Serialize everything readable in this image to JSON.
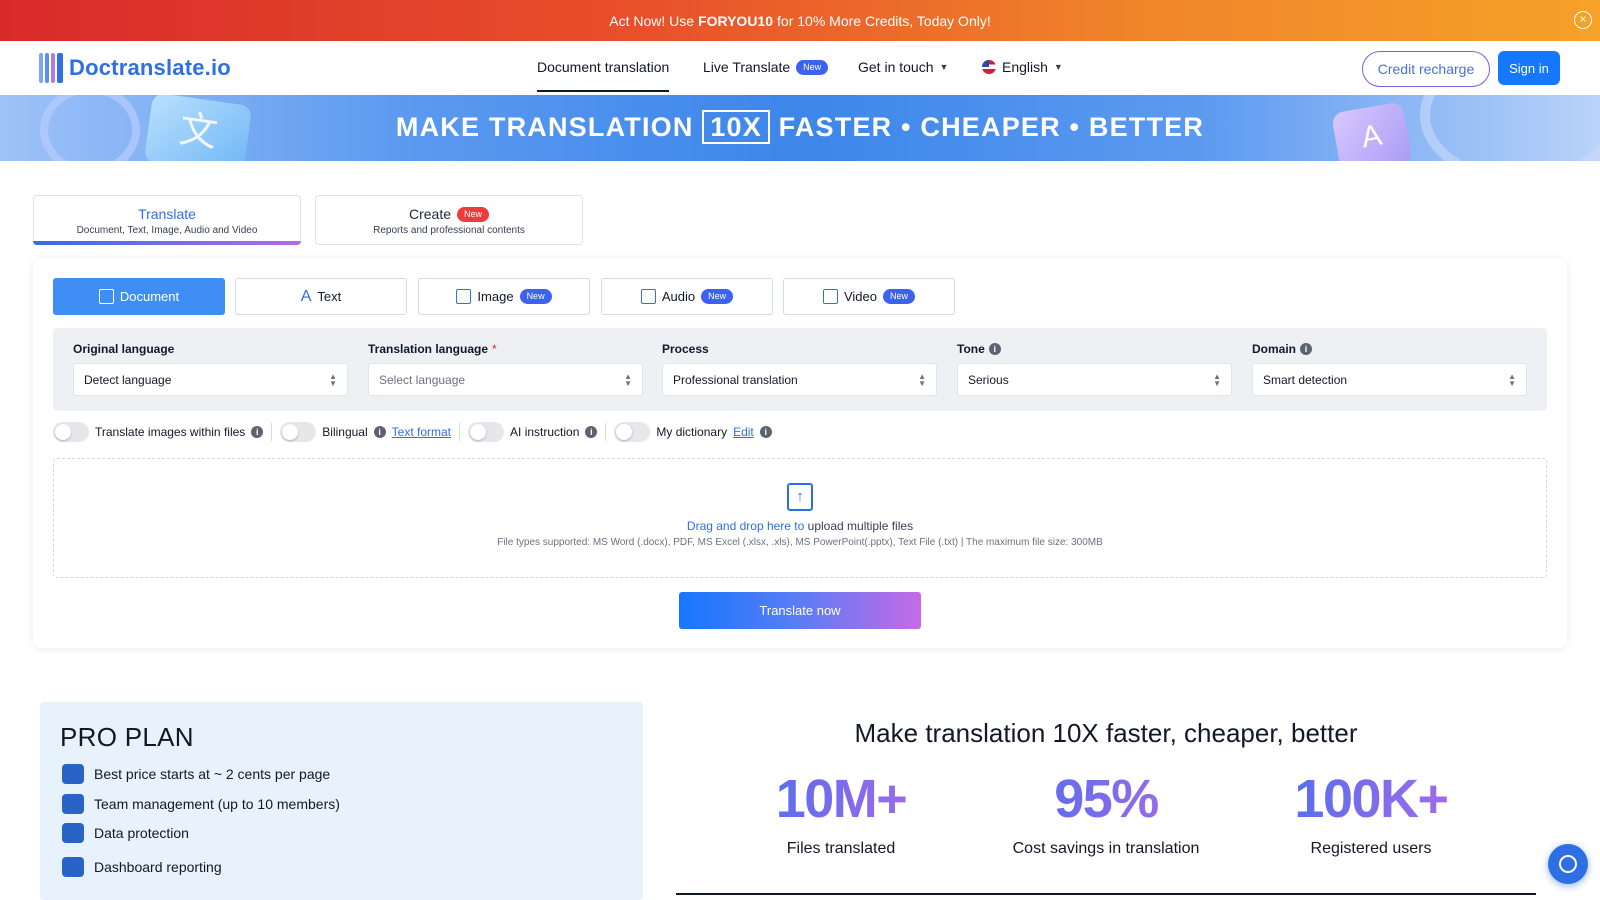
{
  "promo": {
    "prefix": "Act Now! Use",
    "code": "FORYOU10",
    "suffix": "for 10% More Credits, Today Only!"
  },
  "nav": {
    "logo": "Doctranslate.io",
    "links": {
      "document": "Document translation",
      "live": "Live Translate",
      "contact": "Get in touch",
      "language": "English"
    },
    "new_badge": "New",
    "credit": "Credit recharge",
    "signin": "Sign in"
  },
  "banner": {
    "part1": "MAKE TRANSLATION",
    "boxed": "10X",
    "part2": "FASTER • CHEAPER • BETTER",
    "deco1": "文",
    "deco2": "A"
  },
  "modes": {
    "translate": {
      "title": "Translate",
      "sub": "Document, Text, Image, Audio and Video"
    },
    "create": {
      "title": "Create",
      "badge": "New",
      "sub": "Reports and professional contents"
    }
  },
  "types": {
    "document": "Document",
    "text": "Text",
    "image": "Image",
    "audio": "Audio",
    "video": "Video",
    "new_badge": "New"
  },
  "fields": {
    "original": {
      "label": "Original language",
      "value": "Detect language"
    },
    "translation": {
      "label": "Translation language",
      "required": "*",
      "placeholder": "Select language"
    },
    "process": {
      "label": "Process",
      "value": "Professional translation"
    },
    "tone": {
      "label": "Tone",
      "value": "Serious"
    },
    "domain": {
      "label": "Domain",
      "value": "Smart detection"
    }
  },
  "options": {
    "images": "Translate images within files",
    "bilingual": "Bilingual",
    "text_format": "Text format",
    "ai": "AI instruction",
    "dictionary": "My dictionary",
    "edit": "Edit"
  },
  "upload": {
    "link": "Drag and drop here to",
    "rest": "upload multiple files",
    "types": "File types supported: MS Word (.docx), PDF, MS Excel (.xlsx, .xls), MS PowerPoint(.pptx), Text File (.txt) | The maximum file size: 300MB"
  },
  "translate_btn": "Translate now",
  "pro": {
    "title": "PRO PLAN",
    "items": [
      "Best price starts at ~ 2 cents per page",
      "Team management (up to 10 members)",
      "Data protection",
      "Dashboard reporting"
    ]
  },
  "stats": {
    "title": "Make translation 10X faster, cheaper, better",
    "items": [
      {
        "num": "10M+",
        "cap": "Files translated"
      },
      {
        "num": "95%",
        "cap": "Cost savings in translation"
      },
      {
        "num": "100K+",
        "cap": "Registered users"
      }
    ]
  },
  "colors": {
    "brand": "#2f6fe6",
    "primary_button": "#1677ff",
    "accent_purple": "#b96ae6"
  }
}
